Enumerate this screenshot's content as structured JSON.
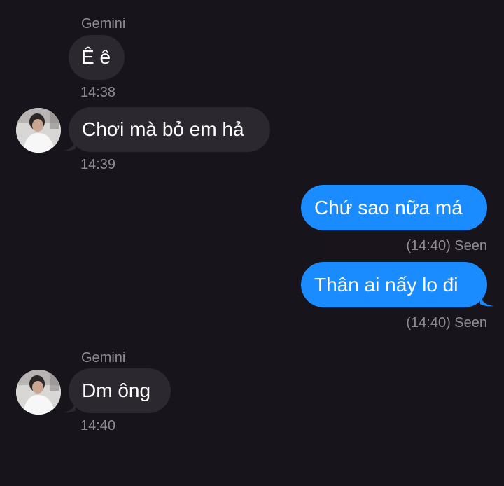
{
  "messages": [
    {
      "sender": "Gemini",
      "text": "Ê ê",
      "time": "14:38"
    },
    {
      "text": "Chơi mà bỏ em hả",
      "time": "14:39"
    },
    {
      "text": "Chứ sao nữa má",
      "status": "(14:40) Seen"
    },
    {
      "text": "Thân ai nấy lo đi",
      "status": "(14:40) Seen"
    },
    {
      "sender": "Gemini",
      "text": "Dm ông",
      "time": "14:40"
    }
  ],
  "colors": {
    "background": "#17151b",
    "incoming_bubble": "#2b292f",
    "outgoing_bubble": "#1a8cff",
    "meta_text": "#8e8c93"
  }
}
